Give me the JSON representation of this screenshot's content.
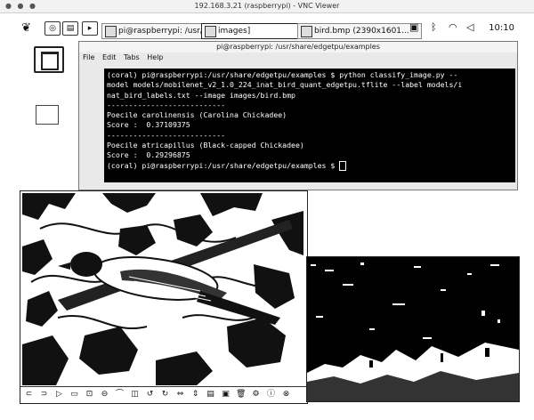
{
  "vnc": {
    "window_controls": "● ● ●",
    "title": "192.168.3.21 (raspberrypi) - VNC Viewer"
  },
  "panel": {
    "menu_icon": "raspberry-pi-icon",
    "launchers": [
      "web-browser-icon",
      "file-manager-icon",
      "terminal-icon"
    ],
    "tasks": [
      {
        "label": "pi@raspberrypi: /usr/s...",
        "icon": "terminal-icon"
      },
      {
        "label": "images]",
        "icon": "folder-icon"
      },
      {
        "label": "bird.bmp (2390x1601...",
        "icon": "image-icon"
      }
    ],
    "tray": [
      "vnc-icon",
      "bluetooth-icon",
      "wifi-icon",
      "volume-icon"
    ],
    "clock": "10:10"
  },
  "terminal": {
    "title": "pi@raspberrypi: /usr/share/edgetpu/examples",
    "menu": [
      "File",
      "Edit",
      "Tabs",
      "Help"
    ],
    "lines": [
      "(coral) pi@raspberrypi:/usr/share/edgetpu/examples $ python classify_image.py --",
      "model models/mobilenet_v2_1.0_224_inat_bird_quant_edgetpu.tflite --label models/i",
      "nat_bird_labels.txt --image images/bird.bmp",
      "---------------------------",
      "Poecile carolinensis (Carolina Chickadee)",
      "Score :  0.37109375",
      "---------------------------",
      "Poecile atricapillus (Black-capped Chickadee)",
      "Score :  0.29296875",
      "(coral) pi@raspberrypi:/usr/share/edgetpu/examples $ "
    ]
  },
  "image_viewer": {
    "toolbar_icons": [
      "prev-icon",
      "next-icon",
      "play-icon",
      "gallery-icon",
      "zoom-in-icon",
      "zoom-out-icon",
      "fit-icon",
      "fullscreen-icon",
      "rotate-left-icon",
      "rotate-right-icon",
      "flip-h-icon",
      "flip-v-icon",
      "open-icon",
      "save-icon",
      "delete-icon",
      "settings-icon",
      "info-icon",
      "exit-icon"
    ],
    "toolbar_glyphs": [
      "⊂",
      "⊃",
      "▷",
      "▭",
      "⊡",
      "⊖",
      "⌒",
      "◫",
      "↺",
      "↻",
      "⇔",
      "⇕",
      "▤",
      "▣",
      "🗑",
      "⚙",
      "ⓘ",
      "⊗"
    ]
  }
}
